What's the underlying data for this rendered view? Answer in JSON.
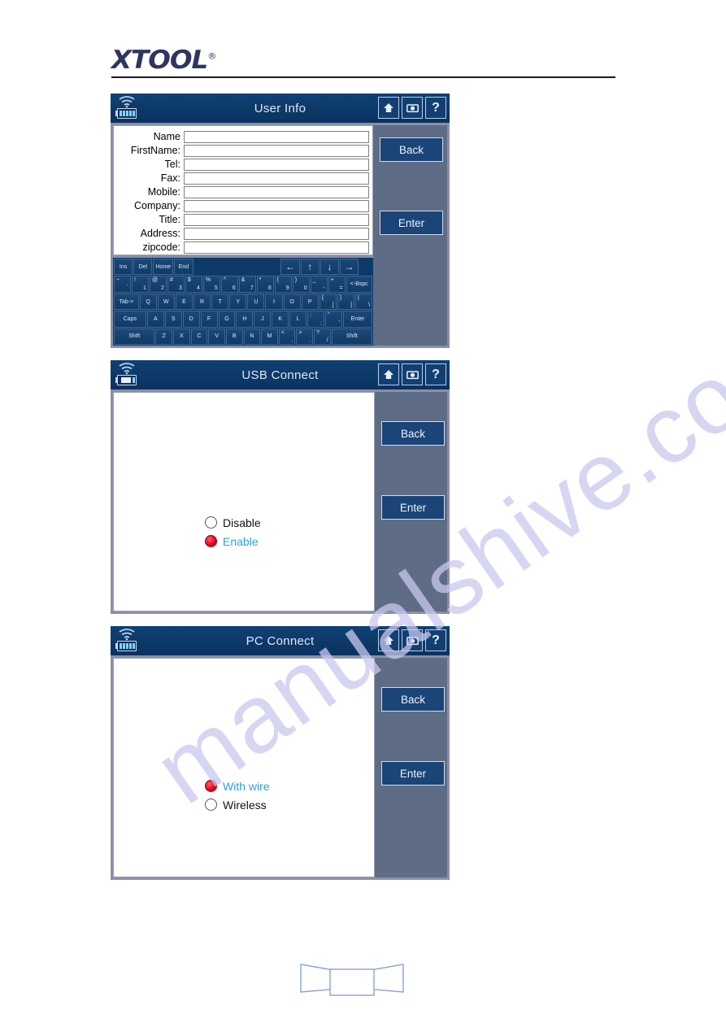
{
  "document": {
    "brand": "XTOOL",
    "brand_mark": "®",
    "watermark": "manualshive.com"
  },
  "panels": [
    {
      "id": "user-info",
      "title": "User Info",
      "status": {
        "wifi": "wifi-icon",
        "battery": "battery-full-icon",
        "battery_level": 5
      },
      "title_buttons": [
        {
          "name": "home-button",
          "glyph": "⌂"
        },
        {
          "name": "camera-button",
          "glyph": "▣"
        },
        {
          "name": "help-button",
          "glyph": "?"
        }
      ],
      "side_buttons": {
        "back": "Back",
        "enter": "Enter"
      },
      "form_fields": [
        {
          "label": "Name",
          "value": ""
        },
        {
          "label": "FirstName:",
          "value": ""
        },
        {
          "label": "Tel:",
          "value": ""
        },
        {
          "label": "Fax:",
          "value": ""
        },
        {
          "label": "Mobile:",
          "value": ""
        },
        {
          "label": "Company:",
          "value": ""
        },
        {
          "label": "Title:",
          "value": ""
        },
        {
          "label": "Address:",
          "value": ""
        },
        {
          "label": "zipcode:",
          "value": ""
        }
      ],
      "keyboard": {
        "row1": [
          "Ins",
          "Del",
          "Home",
          "End",
          "",
          "←",
          "↑",
          "↓",
          "→",
          ""
        ],
        "row2": [
          {
            "up": "~",
            "lo": "`"
          },
          {
            "up": "!",
            "lo": "1"
          },
          {
            "up": "@",
            "lo": "2"
          },
          {
            "up": "#",
            "lo": "3"
          },
          {
            "up": "$",
            "lo": "4"
          },
          {
            "up": "%",
            "lo": "5"
          },
          {
            "up": "^",
            "lo": "6"
          },
          {
            "up": "&",
            "lo": "7"
          },
          {
            "up": "*",
            "lo": "8"
          },
          {
            "up": "(",
            "lo": "9"
          },
          {
            "up": ")",
            "lo": "0"
          },
          {
            "up": "_",
            "lo": "-"
          },
          {
            "up": "+",
            "lo": "="
          },
          {
            "up": "",
            "lo": ""
          }
        ],
        "row2_bspc": "<-Bspc",
        "row3": [
          "Tab->",
          "Q",
          "W",
          "E",
          "R",
          "T",
          "Y",
          "U",
          "I",
          "O",
          "P"
        ],
        "row3_dual": [
          {
            "up": "{",
            "lo": "["
          },
          {
            "up": "}",
            "lo": "]"
          },
          {
            "up": "|",
            "lo": "\\"
          }
        ],
        "row4": [
          "Caps",
          "A",
          "S",
          "D",
          "F",
          "G",
          "H",
          "J",
          "K",
          "L"
        ],
        "row4_dual": [
          {
            "up": ":",
            "lo": ";"
          },
          {
            "up": "\"",
            "lo": "'"
          }
        ],
        "row4_enter": "Enter",
        "row5": [
          "Shift",
          "Z",
          "X",
          "C",
          "V",
          "B",
          "N",
          "M"
        ],
        "row5_dual": [
          {
            "up": "<",
            "lo": ","
          },
          {
            "up": ">",
            "lo": "."
          },
          {
            "up": "?",
            "lo": "/"
          }
        ],
        "row5_shift": "Shift"
      }
    },
    {
      "id": "usb-connect",
      "title": "USB Connect",
      "status": {
        "wifi": "wifi-icon",
        "battery": "battery-low-icon",
        "battery_level": 2
      },
      "title_buttons": [
        {
          "name": "home-button",
          "glyph": "⌂"
        },
        {
          "name": "camera-button",
          "glyph": "▣"
        },
        {
          "name": "help-button",
          "glyph": "?"
        }
      ],
      "side_buttons": {
        "back": "Back",
        "enter": "Enter"
      },
      "options": [
        {
          "label": "Disable",
          "selected": false
        },
        {
          "label": "Enable",
          "selected": true
        }
      ]
    },
    {
      "id": "pc-connect",
      "title": "PC Connect",
      "status": {
        "wifi": "wifi-icon",
        "battery": "battery-full-icon",
        "battery_level": 5
      },
      "title_buttons": [
        {
          "name": "home-button",
          "glyph": "⌂"
        },
        {
          "name": "camera-button",
          "glyph": "▣"
        },
        {
          "name": "help-button",
          "glyph": "?"
        }
      ],
      "side_buttons": {
        "back": "Back",
        "enter": "Enter"
      },
      "options": [
        {
          "label": "With wire",
          "selected": true
        },
        {
          "label": "Wireless",
          "selected": false
        }
      ]
    }
  ],
  "colors": {
    "titlebar": "#0d3a66",
    "side_panel": "#5f6c85",
    "button": "#1b4478",
    "key": "#16406f",
    "selected_text": "#2f9fd8",
    "radio_on": "#e00020",
    "watermark": "#c9c9ee",
    "brand": "#2e3560"
  }
}
